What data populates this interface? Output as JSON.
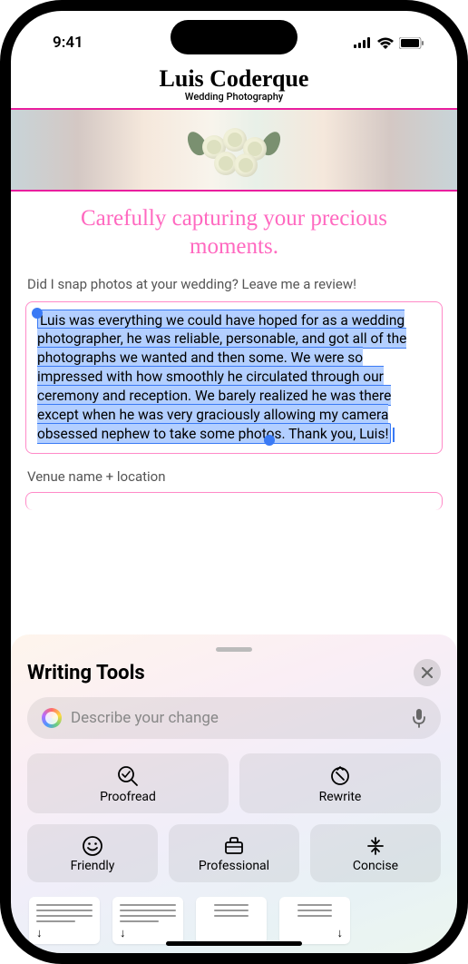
{
  "status": {
    "time": "9:41"
  },
  "header": {
    "brand": "Luis Coderque",
    "subtitle": "Wedding Photography"
  },
  "page": {
    "tagline": "Carefully capturing your precious moments.",
    "review_prompt": "Did I snap photos at your wedding? Leave me a review!",
    "review_text": "Luis was everything we could have hoped for as a wedding photographer, he was reliable, personable, and got all of the photographs we wanted and then some. We were so impressed with how smoothly he circulated through our ceremony and reception. We barely realized he was there except when he was very graciously allowing my camera obsessed nephew to take some photos. Thank you, Luis!",
    "venue_label": "Venue name + location"
  },
  "sheet": {
    "title": "Writing Tools",
    "input_placeholder": "Describe your change",
    "tools": {
      "proofread": "Proofread",
      "rewrite": "Rewrite",
      "friendly": "Friendly",
      "professional": "Professional",
      "concise": "Concise"
    }
  }
}
